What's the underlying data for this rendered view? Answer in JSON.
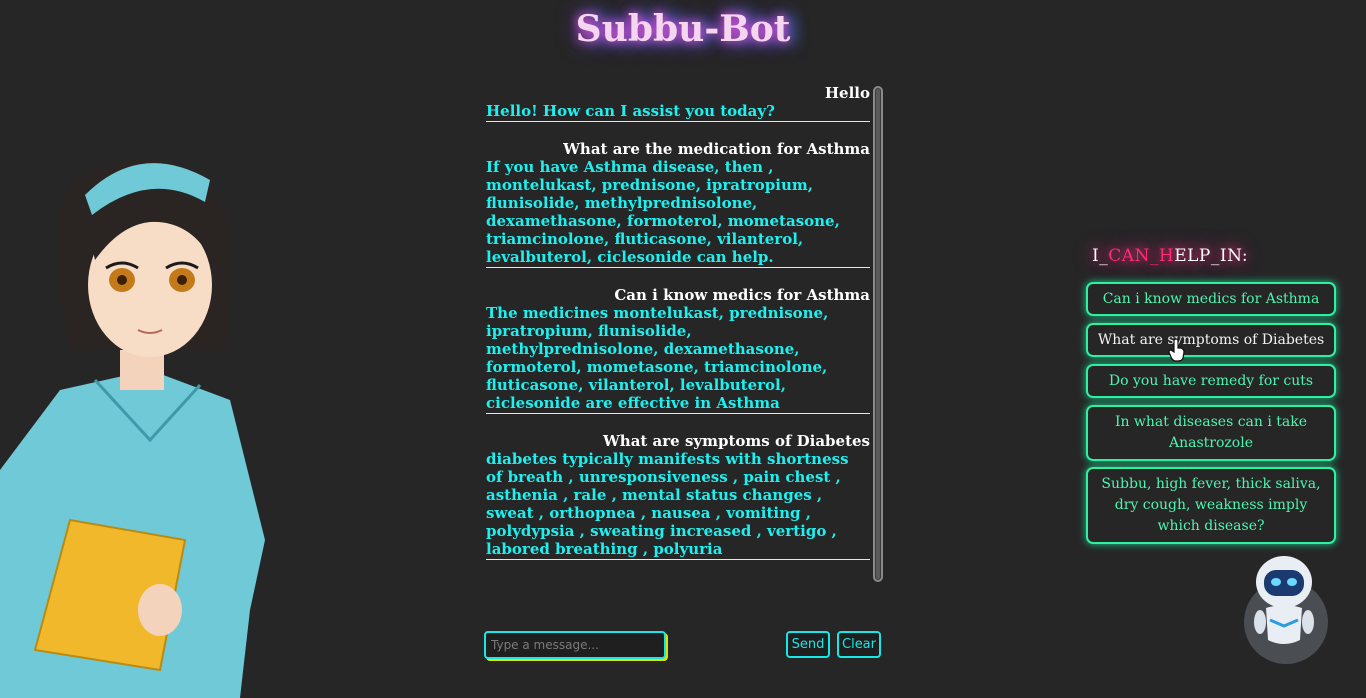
{
  "app": {
    "title": "Subbu-Bot"
  },
  "chat": {
    "messages": [
      {
        "user": "Hello",
        "bot": "Hello! How can I assist you today?"
      },
      {
        "user": "What are the medication for Asthma",
        "bot": "If you have Asthma disease, then ,\nmontelukast, prednisone, ipratropium,\nflunisolide, methylprednisolone,\ndexamethasone, formoterol, mometasone,\ntriamcinolone, fluticasone, vilanterol,\nlevalbuterol, ciclesonide can help."
      },
      {
        "user": "Can i know medics for Asthma",
        "bot": "The medicines montelukast, prednisone,\nipratropium, flunisolide,\nmethylprednisolone, dexamethasone,\nformoterol, mometasone, triamcinolone,\nfluticasone, vilanterol, levalbuterol,\nciclesonide are effective in Asthma"
      },
      {
        "user": "What are symptoms of Diabetes",
        "bot": "diabetes typically manifests with shortness\nof breath , unresponsiveness , pain chest ,\nasthenia , rale , mental status changes ,\nsweat , orthopnea , nausea , vomiting ,\npolydypsia , sweating increased , vertigo ,\nlabored breathing , polyuria"
      }
    ]
  },
  "input": {
    "placeholder": "Type a message..."
  },
  "buttons": {
    "send": "Send",
    "clear": "Clear"
  },
  "help": {
    "title_a": "I_",
    "title_b": "CAN_",
    "title_c": "H",
    "title_d": "ELP_IN:",
    "suggestions": [
      "Can i know medics for Asthma",
      "What are symptoms of Diabetes",
      "Do you have remedy for cuts",
      "In what diseases can i take Anastrozole",
      "Subbu, high fever, thick saliva, dry cough, weakness imply which disease?"
    ]
  },
  "colors": {
    "accent_cyan": "#19e6e6",
    "accent_green": "#2ef0a0",
    "background": "#262626"
  }
}
